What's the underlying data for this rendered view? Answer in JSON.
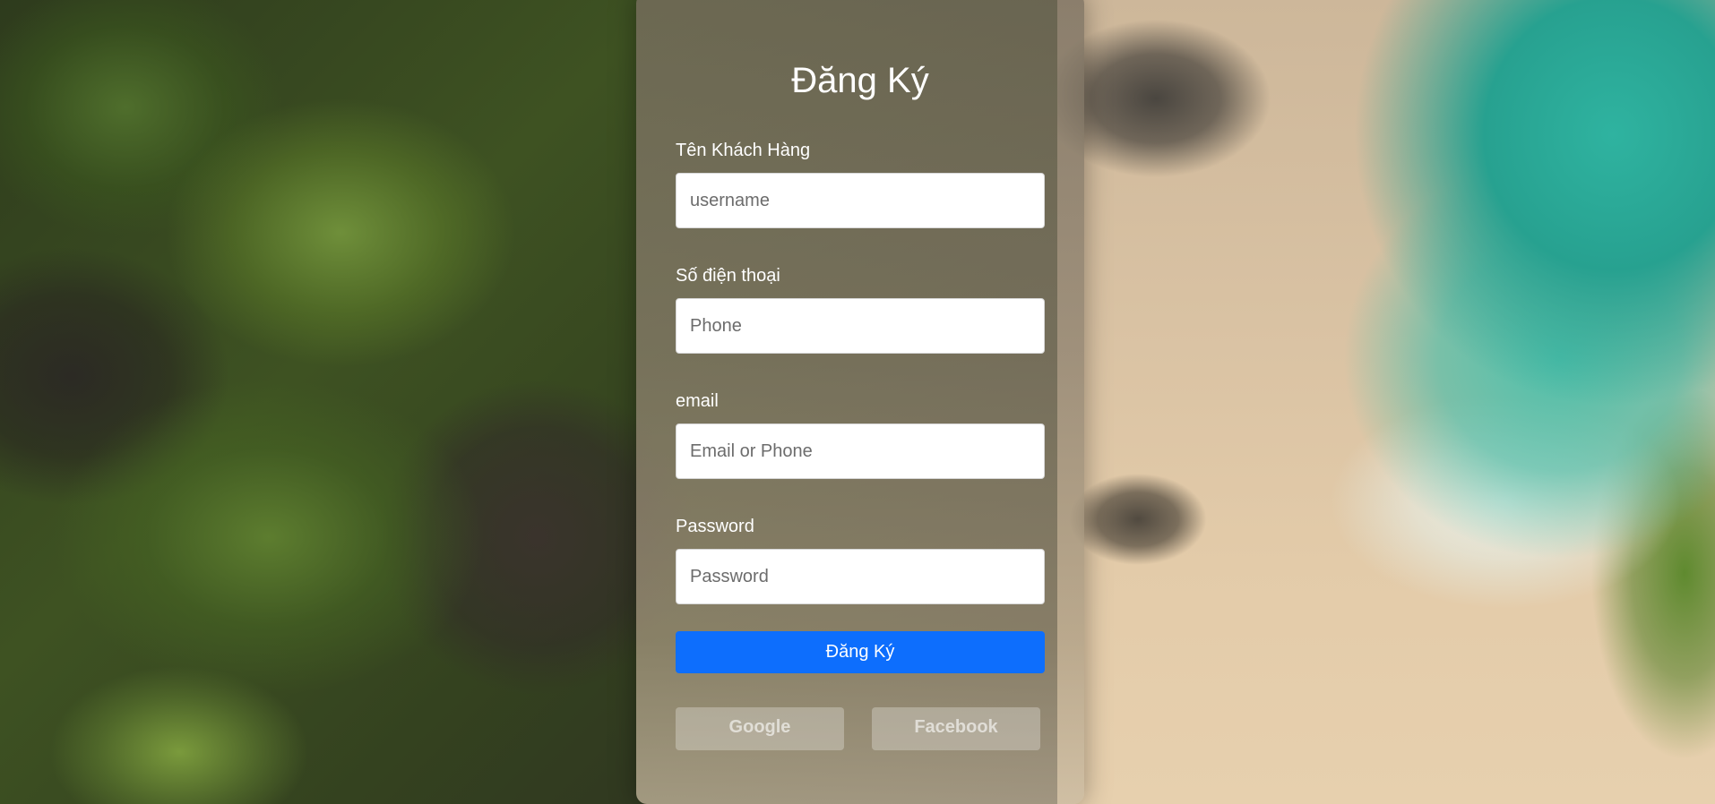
{
  "form": {
    "title": "Đăng Ký",
    "fields": [
      {
        "label": "Tên Khách Hàng",
        "placeholder": "username",
        "value": ""
      },
      {
        "label": "Số điện thoại",
        "placeholder": "Phone",
        "value": ""
      },
      {
        "label": "email",
        "placeholder": "Email or Phone",
        "value": ""
      },
      {
        "label": "Password",
        "placeholder": "Password",
        "value": ""
      }
    ],
    "submit_label": "Đăng Ký",
    "social": {
      "google_label": "Google",
      "facebook_label": "Facebook"
    }
  },
  "colors": {
    "primary_button": "#0d6efd",
    "text": "#ffffff"
  }
}
